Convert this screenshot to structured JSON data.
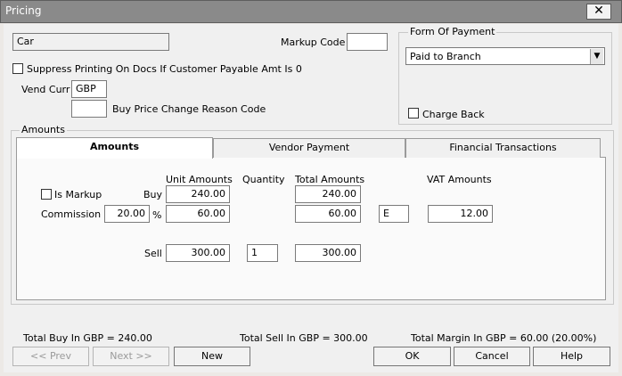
{
  "window": {
    "title": "Pricing",
    "close_glyph": "✕"
  },
  "product": {
    "value": "Car"
  },
  "markup_code": {
    "label": "Markup Code",
    "value": ""
  },
  "suppress": {
    "label": "Suppress Printing On Docs If Customer Payable Amt Is 0",
    "checked": false
  },
  "vend_curr": {
    "label": "Vend Curr",
    "value": "GBP"
  },
  "buy_price_reason": {
    "label": "Buy Price Change Reason Code",
    "value": ""
  },
  "form_of_payment": {
    "legend": "Form Of Payment",
    "selected": "Paid to Branch",
    "charge_back_label": "Charge Back",
    "charge_back_checked": false
  },
  "amounts_group": {
    "legend": "Amounts"
  },
  "tabs": [
    {
      "label": "Amounts",
      "active": true
    },
    {
      "label": "Vendor Payment",
      "active": false
    },
    {
      "label": "Financial Transactions",
      "active": false
    }
  ],
  "grid": {
    "headers": {
      "unit_amounts": "Unit Amounts",
      "quantity": "Quantity",
      "total_amounts": "Total Amounts",
      "vat_amounts": "VAT Amounts"
    },
    "is_markup_label": "Is Markup",
    "is_markup_checked": false,
    "buy_label": "Buy",
    "buy_unit": "240.00",
    "buy_total": "240.00",
    "commission_label": "Commission",
    "commission_pct": "20.00",
    "pct_symbol": "%",
    "commission_unit": "60.00",
    "commission_total": "60.00",
    "vat_code": "E",
    "vat_amount": "12.00",
    "sell_label": "Sell",
    "sell_unit": "300.00",
    "sell_qty": "1",
    "sell_total": "300.00"
  },
  "totals": {
    "buy": "Total Buy In GBP = 240.00",
    "sell": "Total Sell In GBP = 300.00",
    "margin": "Total Margin In GBP = 60.00 (20.00%)"
  },
  "buttons": {
    "prev": "<< Prev",
    "next": "Next >>",
    "new": "New",
    "ok": "OK",
    "cancel": "Cancel",
    "help": "Help"
  }
}
